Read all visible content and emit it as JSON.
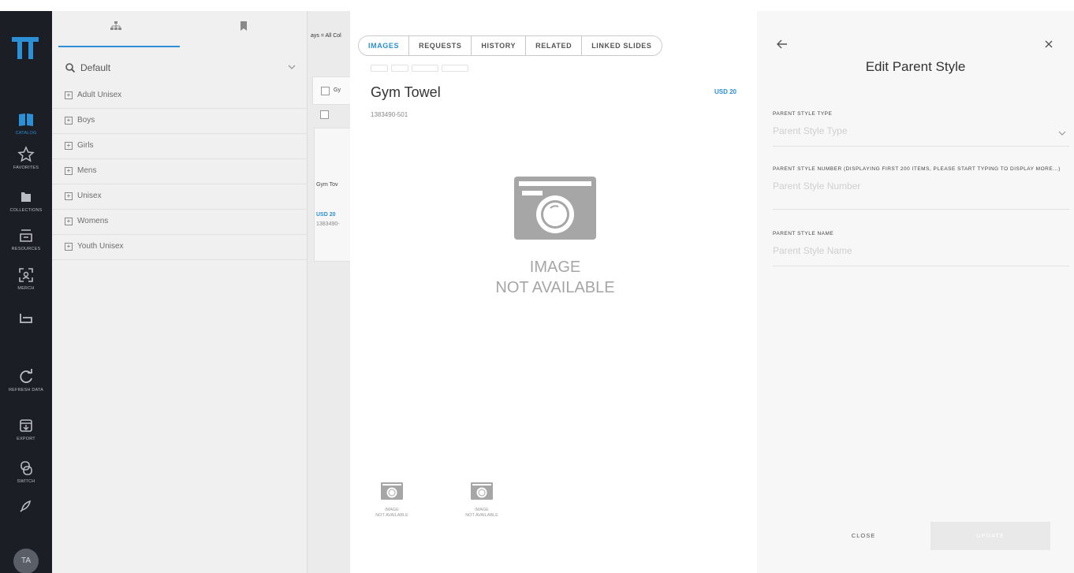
{
  "nav": {
    "items": [
      {
        "label": "CATALOG",
        "icon": "book-icon",
        "active": true
      },
      {
        "label": "FAVORITES",
        "icon": "star-icon"
      },
      {
        "label": "COLLECTIONS",
        "icon": "folder-icon"
      },
      {
        "label": "RESOURCES",
        "icon": "tray-icon"
      },
      {
        "label": "MERCH",
        "icon": "scan-icon"
      },
      {
        "label": "",
        "icon": "basket-icon"
      },
      {
        "label": "REFRESH DATA",
        "icon": "refresh-icon"
      },
      {
        "label": "EXPORT",
        "icon": "export-icon"
      },
      {
        "label": "SWITCH",
        "icon": "switch-icon"
      },
      {
        "label": "",
        "icon": "rocket-icon"
      }
    ],
    "avatar": "TA"
  },
  "tree": {
    "search": "Default",
    "items": [
      "Adult Unisex",
      "Boys",
      "Girls",
      "Mens",
      "Unisex",
      "Womens",
      "Youth Unisex"
    ]
  },
  "results": {
    "crumb": "ays = All Col",
    "card_head": "Gy",
    "card_name": "Gym Tov",
    "card_price": "USD 20",
    "card_sku": "1383490-"
  },
  "detail": {
    "tabs": [
      "IMAGES",
      "REQUESTS",
      "HISTORY",
      "RELATED",
      "LINKED SLIDES"
    ],
    "active_tab": "IMAGES",
    "title": "Gym Towel",
    "price": "USD 20",
    "sku": "1383490-501",
    "image_placeholder": {
      "line1": "IMAGE",
      "line2": "NOT AVAILABLE"
    },
    "thumbnails": [
      {
        "line1": "IMAGE",
        "line2": "NOT AVAILABLE"
      },
      {
        "line1": "IMAGE",
        "line2": "NOT AVAILABLE"
      }
    ]
  },
  "edit": {
    "title": "Edit Parent Style",
    "fields": [
      {
        "label": "PARENT STYLE TYPE",
        "placeholder": "Parent Style Type"
      },
      {
        "label": "PARENT STYLE NUMBER (DISPLAYING FIRST 200 ITEMS, PLEASE START TYPING TO DISPLAY MORE...)",
        "placeholder": "Parent Style Number"
      },
      {
        "label": "PARENT STYLE NAME",
        "placeholder": "Parent Style Name"
      }
    ],
    "close_label": "CLOSE",
    "update_label": "UPDATE"
  },
  "colors": {
    "accent": "#2d8fd5",
    "rail": "#1b1e24"
  }
}
